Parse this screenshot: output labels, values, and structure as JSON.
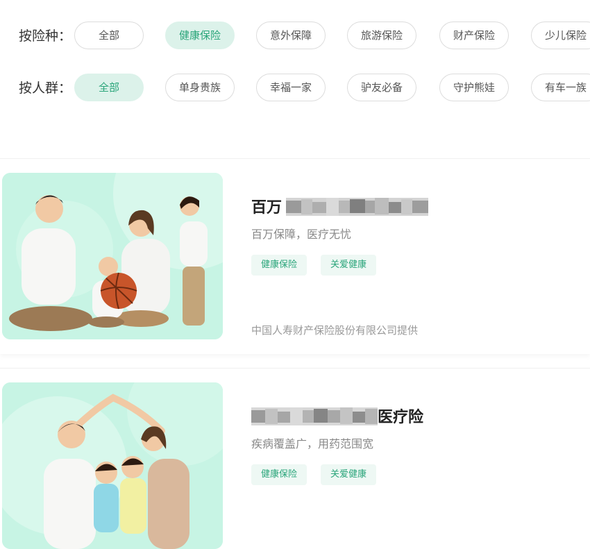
{
  "filters": {
    "category_label": "按险种：",
    "category_chips": [
      "全部",
      "健康保险",
      "意外保障",
      "旅游保险",
      "财产保险",
      "少儿保险"
    ],
    "category_active": "健康保险",
    "group_label": "按人群：",
    "group_chips": [
      "全部",
      "单身贵族",
      "幸福一家",
      "驴友必备",
      "守护熊娃",
      "有车一族"
    ],
    "group_active": "全部"
  },
  "products": [
    {
      "title_visible": "百万",
      "subtitle": "百万保障，医疗无忧",
      "tags": [
        "健康保险",
        "关爱健康"
      ],
      "provider": "中国人寿财产保险股份有限公司提供",
      "image": "family-with-basketball-photo"
    },
    {
      "title_visible": "医疗险",
      "subtitle": "疾病覆盖广，用药范围宽",
      "tags": [
        "健康保险",
        "关爱健康"
      ],
      "image": "family-under-roof-photo"
    }
  ],
  "colors": {
    "accent": "#2aa57a",
    "chip_active_bg": "#dcf2ea",
    "tag_bg": "#eef8f4",
    "image_bg": "#c7f4e4"
  }
}
